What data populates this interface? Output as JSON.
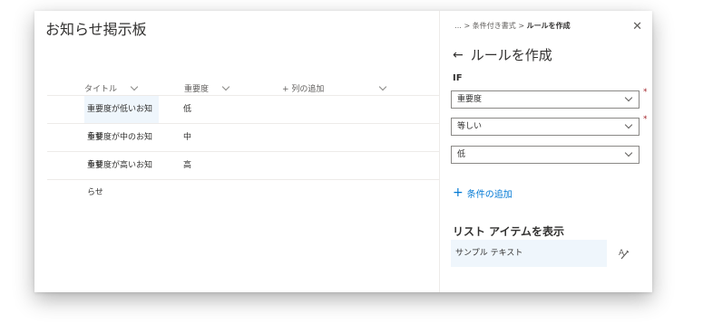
{
  "list": {
    "title": "お知らせ掲示板",
    "columns": {
      "title": "タイトル",
      "importance": "重要度",
      "add_column": "+ 列の追加"
    },
    "rows": [
      {
        "title": "重要度が低いお知らせ",
        "importance": "低"
      },
      {
        "title": "重要度が中のお知らせ",
        "importance": "中"
      },
      {
        "title": "重要度が高いお知らせ",
        "importance": "高"
      }
    ]
  },
  "panel": {
    "breadcrumb": {
      "ellipsis": "…",
      "parent": "条件付き書式",
      "current": "ルールを作成"
    },
    "close_icon": "close-icon",
    "heading": "ルールを作成",
    "if_label": "IF",
    "conditions": {
      "field": "重要度",
      "operator": "等しい",
      "value": "低"
    },
    "add_condition": "条件の追加",
    "show_item_label": "リスト アイテムを表示",
    "sample_text": "サンプル テキスト"
  },
  "colors": {
    "accent": "#0078d4",
    "highlight": "#eff6fc",
    "required": "#a4262c"
  }
}
